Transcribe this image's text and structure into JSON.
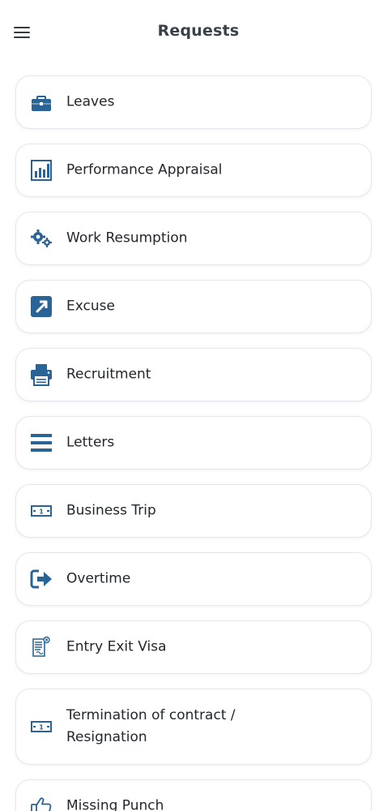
{
  "header": {
    "title": "Requests",
    "menu_icon": "hamburger-menu-icon"
  },
  "colors": {
    "accent": "#2a6496",
    "text": "#22272e",
    "title": "#3b414b",
    "card_border": "#e6e7ea"
  },
  "requests": [
    {
      "label": "Leaves",
      "icon": "briefcase-icon"
    },
    {
      "label": "Performance Appraisal",
      "icon": "bar-chart-icon"
    },
    {
      "label": "Work Resumption",
      "icon": "gears-icon"
    },
    {
      "label": "Excuse",
      "icon": "external-arrow-icon"
    },
    {
      "label": "Recruitment",
      "icon": "printer-icon"
    },
    {
      "label": "Letters",
      "icon": "lines-icon"
    },
    {
      "label": "Business Trip",
      "icon": "money-bill-icon"
    },
    {
      "label": "Overtime",
      "icon": "sign-out-icon"
    },
    {
      "label": "Entry Exit Visa",
      "icon": "visa-document-icon"
    },
    {
      "label_line1": "Termination of contract /",
      "label_line2": "Resignation",
      "icon": "money-bill-icon"
    },
    {
      "label": "Missing Punch",
      "icon": "thumbs-up-icon"
    }
  ]
}
